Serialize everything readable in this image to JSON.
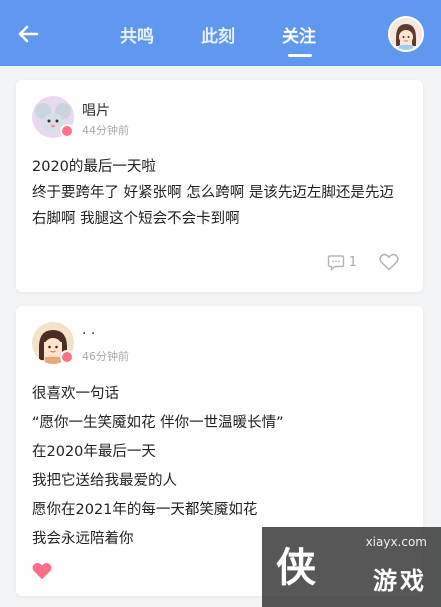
{
  "header": {
    "tabs": [
      {
        "label": "共鸣"
      },
      {
        "label": "此刻"
      },
      {
        "label": "关注"
      }
    ],
    "active_tab": 2,
    "colors": {
      "bar": "#5f98ee",
      "heart_active": "#ff6f86"
    }
  },
  "posts": [
    {
      "username": "唱片",
      "time": "44分钟前",
      "text": "2020的最后一天啦\n终于要跨年了 好紧张啊 怎么跨啊 是该先迈左脚还是先迈右脚啊 我腿这个短会不会卡到啊",
      "comment_count": "1",
      "liked": false
    },
    {
      "username": "· ·",
      "time": "46分钟前",
      "text": "很喜欢一句话\n“愿你一生笑魇如花 伴你一世温暖长情”\n在2020年最后一天\n我把它送给我最爱的人\n愿你在2021年的每一天都笑魇如花\n我会永远陪着你",
      "liked": true
    }
  ],
  "watermark": {
    "site": "xiayx.com",
    "logo_char": "侠",
    "brand": "游戏"
  }
}
